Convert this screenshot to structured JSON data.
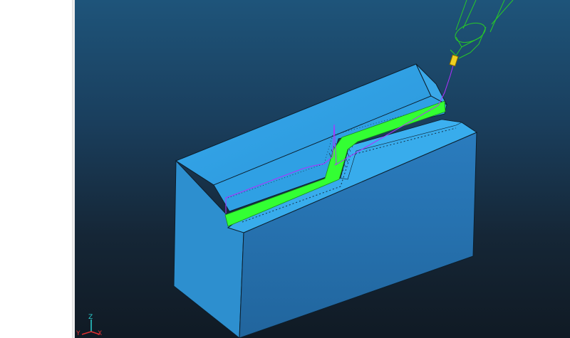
{
  "viewport": {
    "background_top": "#1e547a",
    "background_bottom": "#101a24"
  },
  "model": {
    "block_color": "#2e9ee0",
    "toolpath_color": "#33ff33",
    "tool_holder_color": "#28c828",
    "tool_tip_color": "#f0d020",
    "path_line_color": "#b030ff"
  },
  "triad": {
    "z_label": "Z",
    "x_label": "X",
    "y_label": "Y"
  }
}
